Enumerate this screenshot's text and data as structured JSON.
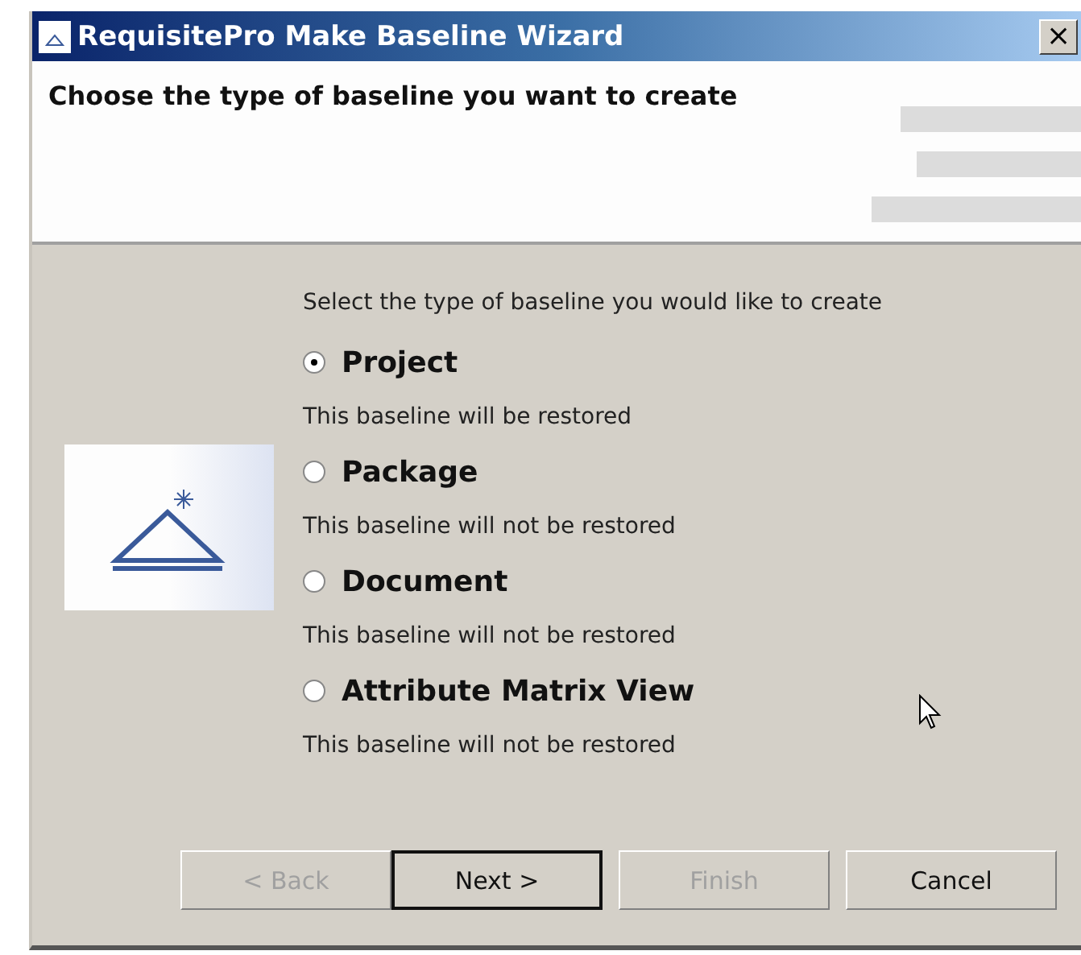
{
  "window": {
    "title": "RequisitePro Make Baseline Wizard",
    "close": "×"
  },
  "header": {
    "title": "Choose the type of baseline you want to create"
  },
  "prompt": "Select the type of baseline you would like to create",
  "options": [
    {
      "label": "Project",
      "description": "This baseline will be restored",
      "selected": true
    },
    {
      "label": "Package",
      "description": "This baseline will not be restored",
      "selected": false
    },
    {
      "label": "Document",
      "description": "This baseline will not be restored",
      "selected": false
    },
    {
      "label": "Attribute Matrix View",
      "description": "This baseline will not be restored",
      "selected": false
    }
  ],
  "buttons": [
    {
      "label": "< Back",
      "disabled": true,
      "default": false
    },
    {
      "label": "Next >",
      "disabled": false,
      "default": true
    },
    {
      "label": "Finish",
      "disabled": true,
      "default": false
    },
    {
      "label": "Cancel",
      "disabled": false,
      "default": false
    }
  ]
}
